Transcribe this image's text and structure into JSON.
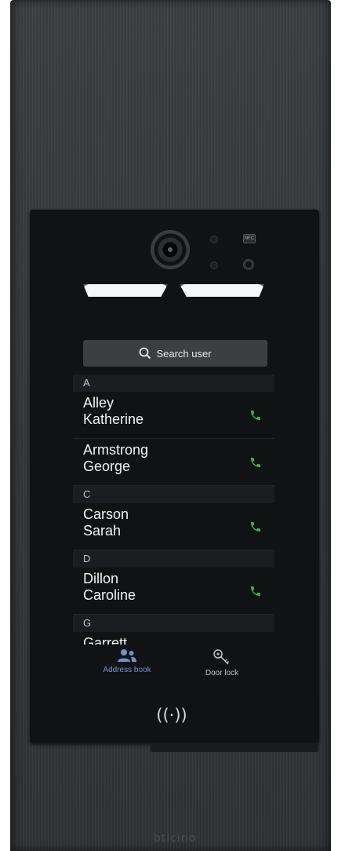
{
  "search": {
    "label": "Search user"
  },
  "badge": {
    "text": "NFC"
  },
  "contacts": {
    "sections": [
      {
        "letter": "A",
        "people": [
          {
            "last": "Alley",
            "first": "Katherine"
          },
          {
            "last": "Armstrong",
            "first": "George"
          }
        ]
      },
      {
        "letter": "C",
        "people": [
          {
            "last": "Carson",
            "first": "Sarah"
          }
        ]
      },
      {
        "letter": "D",
        "people": [
          {
            "last": "Dillon",
            "first": "Caroline"
          }
        ]
      },
      {
        "letter": "G",
        "people": [
          {
            "last": "Garrett",
            "first": ""
          }
        ]
      }
    ]
  },
  "nav": {
    "address_book": "Address book",
    "door_lock": "Door lock"
  },
  "nfc": {
    "symbol": "((·))"
  },
  "brand": {
    "name": "bticino"
  },
  "colors": {
    "accent": "#6f93cf",
    "call_icon": "#4caf50",
    "screen_bg": "#111214",
    "panel": "#36383c"
  },
  "icons": {
    "search": "search-icon",
    "call": "phone-icon",
    "address_book": "users-icon",
    "door_lock": "key-icon",
    "nfc": "nfc-icon"
  }
}
